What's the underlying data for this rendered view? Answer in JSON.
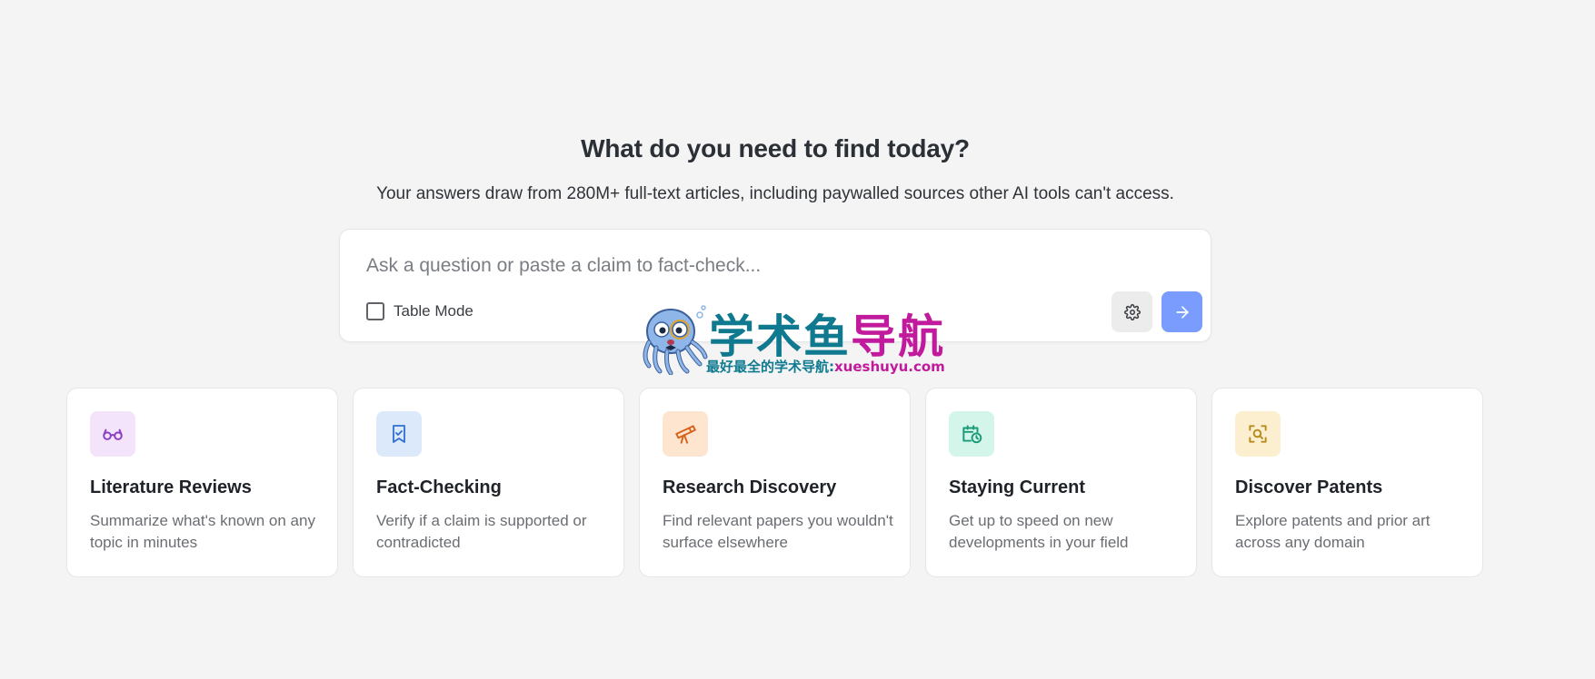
{
  "hero": {
    "title": "What do you need to find today?",
    "subtitle": "Your answers draw from 280M+ full-text articles, including paywalled sources other AI tools can't access."
  },
  "search": {
    "placeholder": "Ask a question or paste a claim to fact-check...",
    "value": "",
    "table_mode_label": "Table Mode",
    "table_mode_checked": false,
    "settings_icon": "gear-icon",
    "submit_icon": "arrow-right-icon"
  },
  "watermark": {
    "title_part1": "学术鱼",
    "title_part2": "导航",
    "subtitle": "最好最全的学术导航:",
    "url": "xueshuyu.com"
  },
  "cards": [
    {
      "title": "Literature Reviews",
      "description": "Summarize what's known on any topic in minutes",
      "icon": "glasses-icon",
      "icon_bg": "#f3e3fb",
      "icon_color": "#8a3fc4"
    },
    {
      "title": "Fact-Checking",
      "description": "Verify if a claim is supported or contradicted",
      "icon": "bookmark-check-icon",
      "icon_bg": "#dce9fb",
      "icon_color": "#2f6fd1"
    },
    {
      "title": "Research Discovery",
      "description": "Find relevant papers you wouldn't surface elsewhere",
      "icon": "telescope-icon",
      "icon_bg": "#fde5cf",
      "icon_color": "#d8621a"
    },
    {
      "title": "Staying Current",
      "description": "Get up to speed on new developments in your field",
      "icon": "calendar-clock-icon",
      "icon_bg": "#d3f5ea",
      "icon_color": "#1a9a78"
    },
    {
      "title": "Discover Patents",
      "description": "Explore patents and prior art across any domain",
      "icon": "patent-search-icon",
      "icon_bg": "#fcefcf",
      "icon_color": "#b98a1c"
    }
  ]
}
